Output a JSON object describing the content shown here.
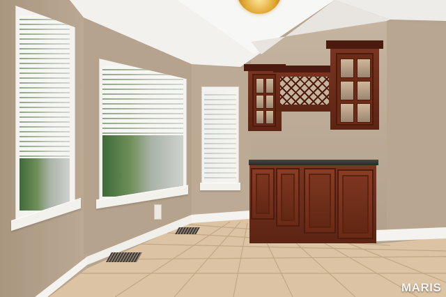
{
  "watermark": {
    "text": "MARIS"
  },
  "colors": {
    "wall": "#b9a893",
    "ceiling": "#f3f2ef",
    "tile": "#dcc3a3",
    "cabinet": "#6f2c18",
    "trim": "#f5f3ef"
  }
}
